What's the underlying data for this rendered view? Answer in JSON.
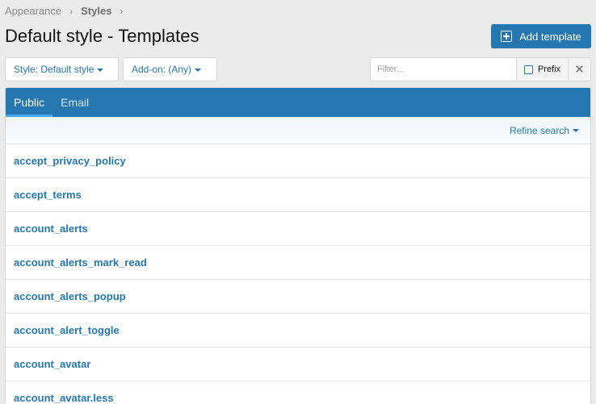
{
  "breadcrumb": {
    "items": [
      "Appearance",
      "Styles"
    ]
  },
  "page": {
    "title": "Default style - Templates"
  },
  "actions": {
    "add_template": "Add template"
  },
  "filters": {
    "style": "Style: Default style",
    "addon": "Add-on: (Any)",
    "filter_placeholder": "Filter...",
    "prefix_label": "Prefix",
    "clear_symbol": "✕"
  },
  "tabs": [
    {
      "label": "Public",
      "active": true
    },
    {
      "label": "Email",
      "active": false
    }
  ],
  "refine": {
    "label": "Refine search"
  },
  "templates": [
    "accept_privacy_policy",
    "accept_terms",
    "account_alerts",
    "account_alerts_mark_read",
    "account_alerts_popup",
    "account_alert_toggle",
    "account_avatar",
    "account_avatar.less"
  ],
  "colors": {
    "accent": "#2577b1",
    "background": "#ebebeb"
  }
}
